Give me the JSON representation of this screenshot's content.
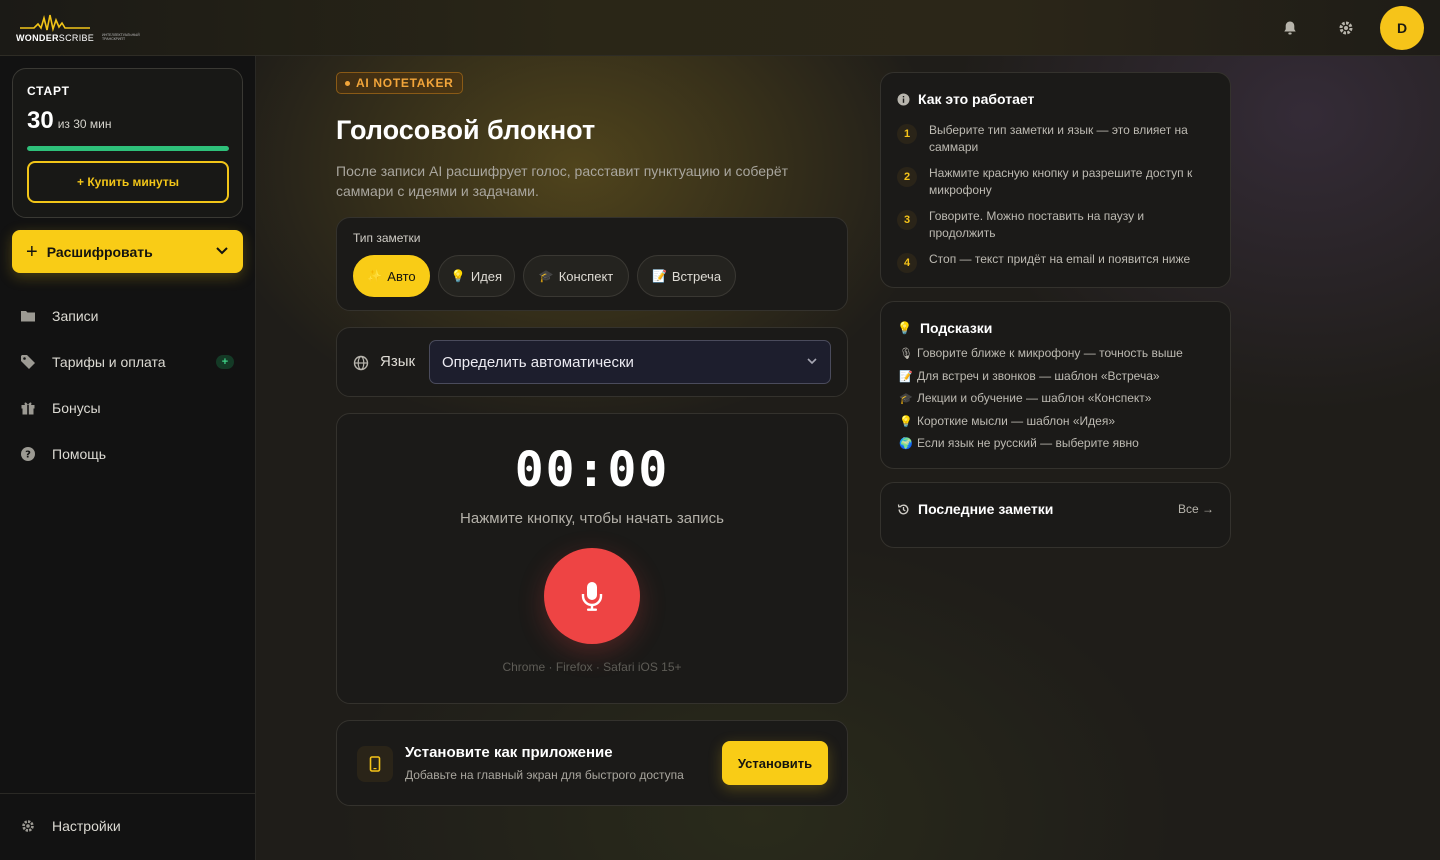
{
  "logo": {
    "word_bold": "WONDER",
    "word_thin": "SCRIBE",
    "tagline": "ИНТЕЛЛЕКТУАЛЬНЫЙ ТРАНСКРИПТ"
  },
  "user": {
    "avatar_letter": "D"
  },
  "plan": {
    "name": "СТАРТ",
    "used": "30",
    "of_text": "из 30 мин",
    "progress": 1.0,
    "buy_label": "+ Купить минуты"
  },
  "sidebar": {
    "transcribe_label": "Расшифровать",
    "items": [
      {
        "label": "Записи",
        "icon": "folder-icon"
      },
      {
        "label": "Тарифы и оплата",
        "icon": "tag-icon",
        "badge": "+"
      },
      {
        "label": "Бонусы",
        "icon": "gift-icon"
      },
      {
        "label": "Помощь",
        "icon": "help-icon"
      }
    ],
    "settings_label": "Настройки"
  },
  "hero": {
    "pill": "AI NOTETAKER",
    "title": "Голосовой блокнот",
    "lead": "После записи AI расшифрует голос, расставит пунктуацию и соберёт саммари с идеями и задачами."
  },
  "note_type": {
    "label": "Тип заметки",
    "chips": [
      {
        "label": "Авто",
        "emoji": "✨",
        "active": true
      },
      {
        "label": "Идея",
        "emoji": "💡",
        "active": false
      },
      {
        "label": "Конспект",
        "emoji": "🎓",
        "active": false
      },
      {
        "label": "Встреча",
        "emoji": "📝",
        "active": false
      }
    ]
  },
  "language": {
    "label": "Язык",
    "selected": "Определить автоматически"
  },
  "recorder": {
    "timer": "00:00",
    "hint": "Нажмите кнопку, чтобы начать запись",
    "browsers": "Chrome · Firefox · Safari iOS 15+"
  },
  "install": {
    "title": "Установите как приложение",
    "subtitle": "Добавьте на главный экран для быстрого доступа",
    "button": "Установить"
  },
  "how_it_works": {
    "title": "Как это работает",
    "steps": [
      {
        "num": "1",
        "text": "Выберите тип заметки и язык — это влияет на саммари"
      },
      {
        "num": "2",
        "text": "Нажмите красную кнопку и разрешите доступ к микрофону"
      },
      {
        "num": "3",
        "text": "Говорите. Можно поставить на паузу и продолжить"
      },
      {
        "num": "4",
        "text": "Стоп — текст придёт на email и появится ниже"
      }
    ]
  },
  "tips": {
    "title": "Подсказки",
    "items": [
      {
        "emoji": "🎙",
        "text": "Говорите ближе к микрофону — точность выше"
      },
      {
        "emoji": "📝",
        "text": "Для встреч и звонков — шаблон «Встреча»"
      },
      {
        "emoji": "🎓",
        "text": "Лекции и обучение — шаблон «Конспект»"
      },
      {
        "emoji": "💡",
        "text": "Короткие мысли — шаблон «Идея»"
      },
      {
        "emoji": "🌍",
        "text": "Если язык не русский — выберите явно"
      }
    ]
  },
  "recent": {
    "title": "Последние заметки",
    "all_link": "Все →"
  },
  "colors": {
    "accent": "#f9cc16",
    "record": "#ee4444",
    "progress": "#2ec07a",
    "pill": "#f2a53a"
  }
}
